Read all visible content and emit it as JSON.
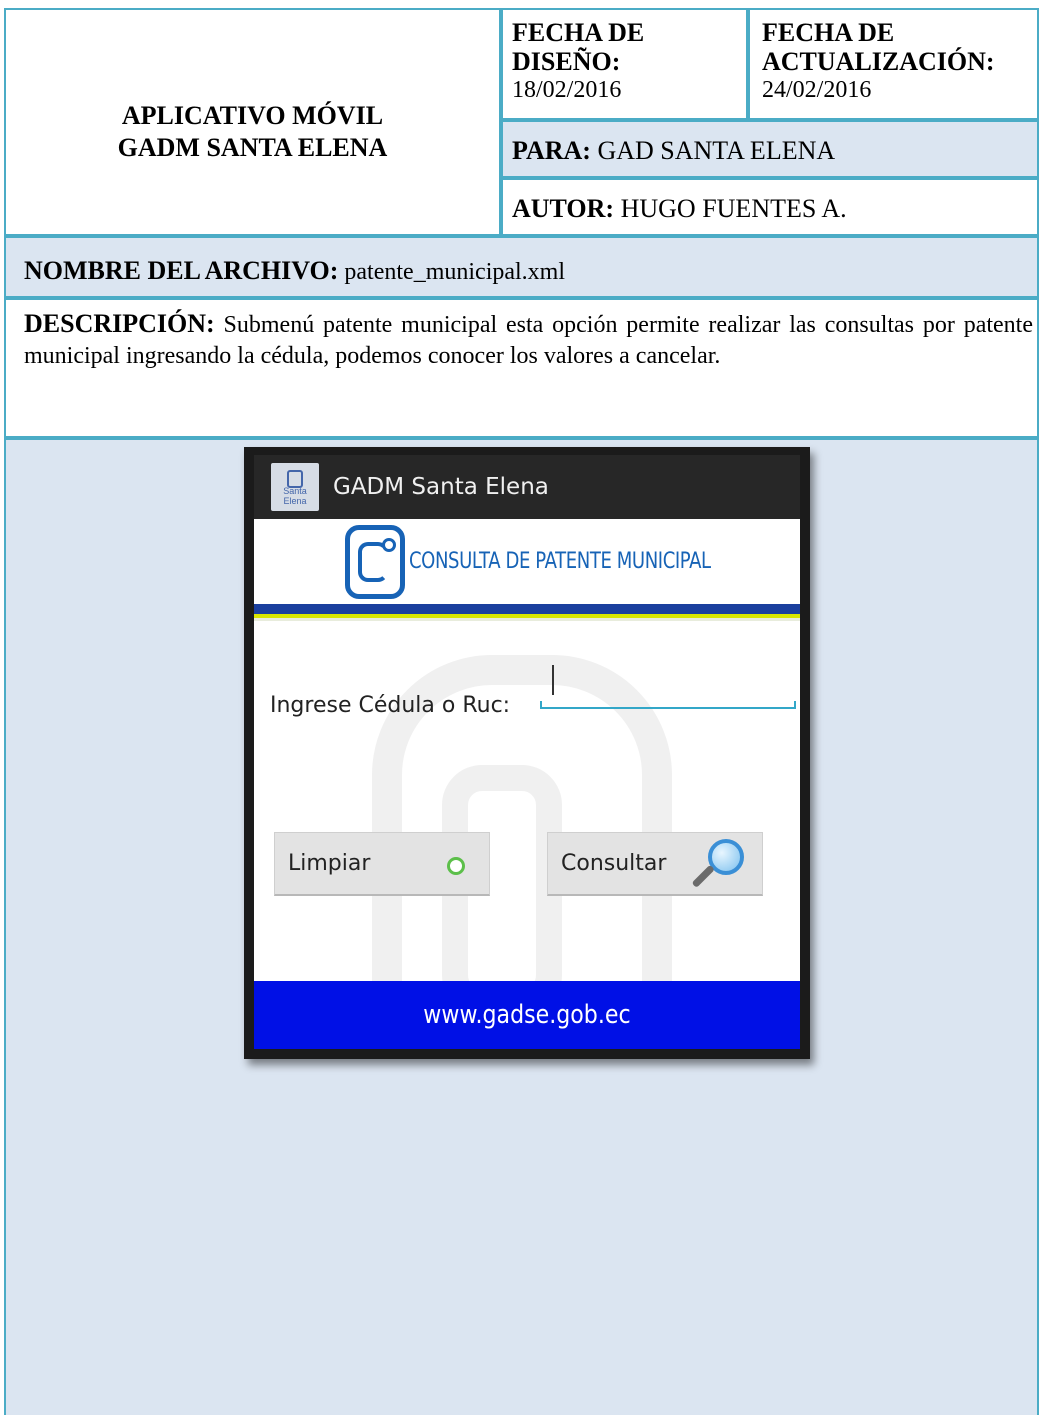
{
  "document": {
    "title_line1": "APLICATIVO MÓVIL",
    "title_line2": "GADM SANTA ELENA",
    "fecha_diseno_label_1": "FECHA DE",
    "fecha_diseno_label_2": "DISEÑO:",
    "fecha_diseno_value": "18/02/2016",
    "fecha_act_label_1": "FECHA DE",
    "fecha_act_label_2": "ACTUALIZACIÓN:",
    "fecha_act_value": "24/02/2016",
    "para_label": "PARA:",
    "para_value": " GAD SANTA ELENA",
    "autor_label": "AUTOR:",
    "autor_value": " HUGO FUENTES A.",
    "nombre_label": "NOMBRE DEL ARCHIVO:",
    "nombre_value": " patente_municipal.xml",
    "descripcion_label": "DESCRIPCIÓN:",
    "descripcion_value": " Submenú patente municipal esta opción permite realizar las consultas por patente municipal ingresando la cédula, podemos conocer los valores a cancelar.",
    "border_color": "#4bacc6",
    "shaded_color": "#dbe5f1"
  },
  "app": {
    "actionbar_title": "GADM Santa Elena",
    "app_icon_text": "Santa Elena",
    "banner_text": "CONSULTA DE PATENTE MUNICIPAL",
    "field_label": "Ingrese Cédula o Ruc:",
    "field_value": "",
    "btn_limpiar": "Limpiar",
    "btn_consultar": "Consultar",
    "footer_url": "www.gadse.gob.ec",
    "icons": [
      "app-logo-icon",
      "gadse-logo-icon",
      "refresh-icon",
      "magnifier-icon"
    ],
    "brand_blue": "#1763b6",
    "footer_blue": "#0010e6"
  }
}
